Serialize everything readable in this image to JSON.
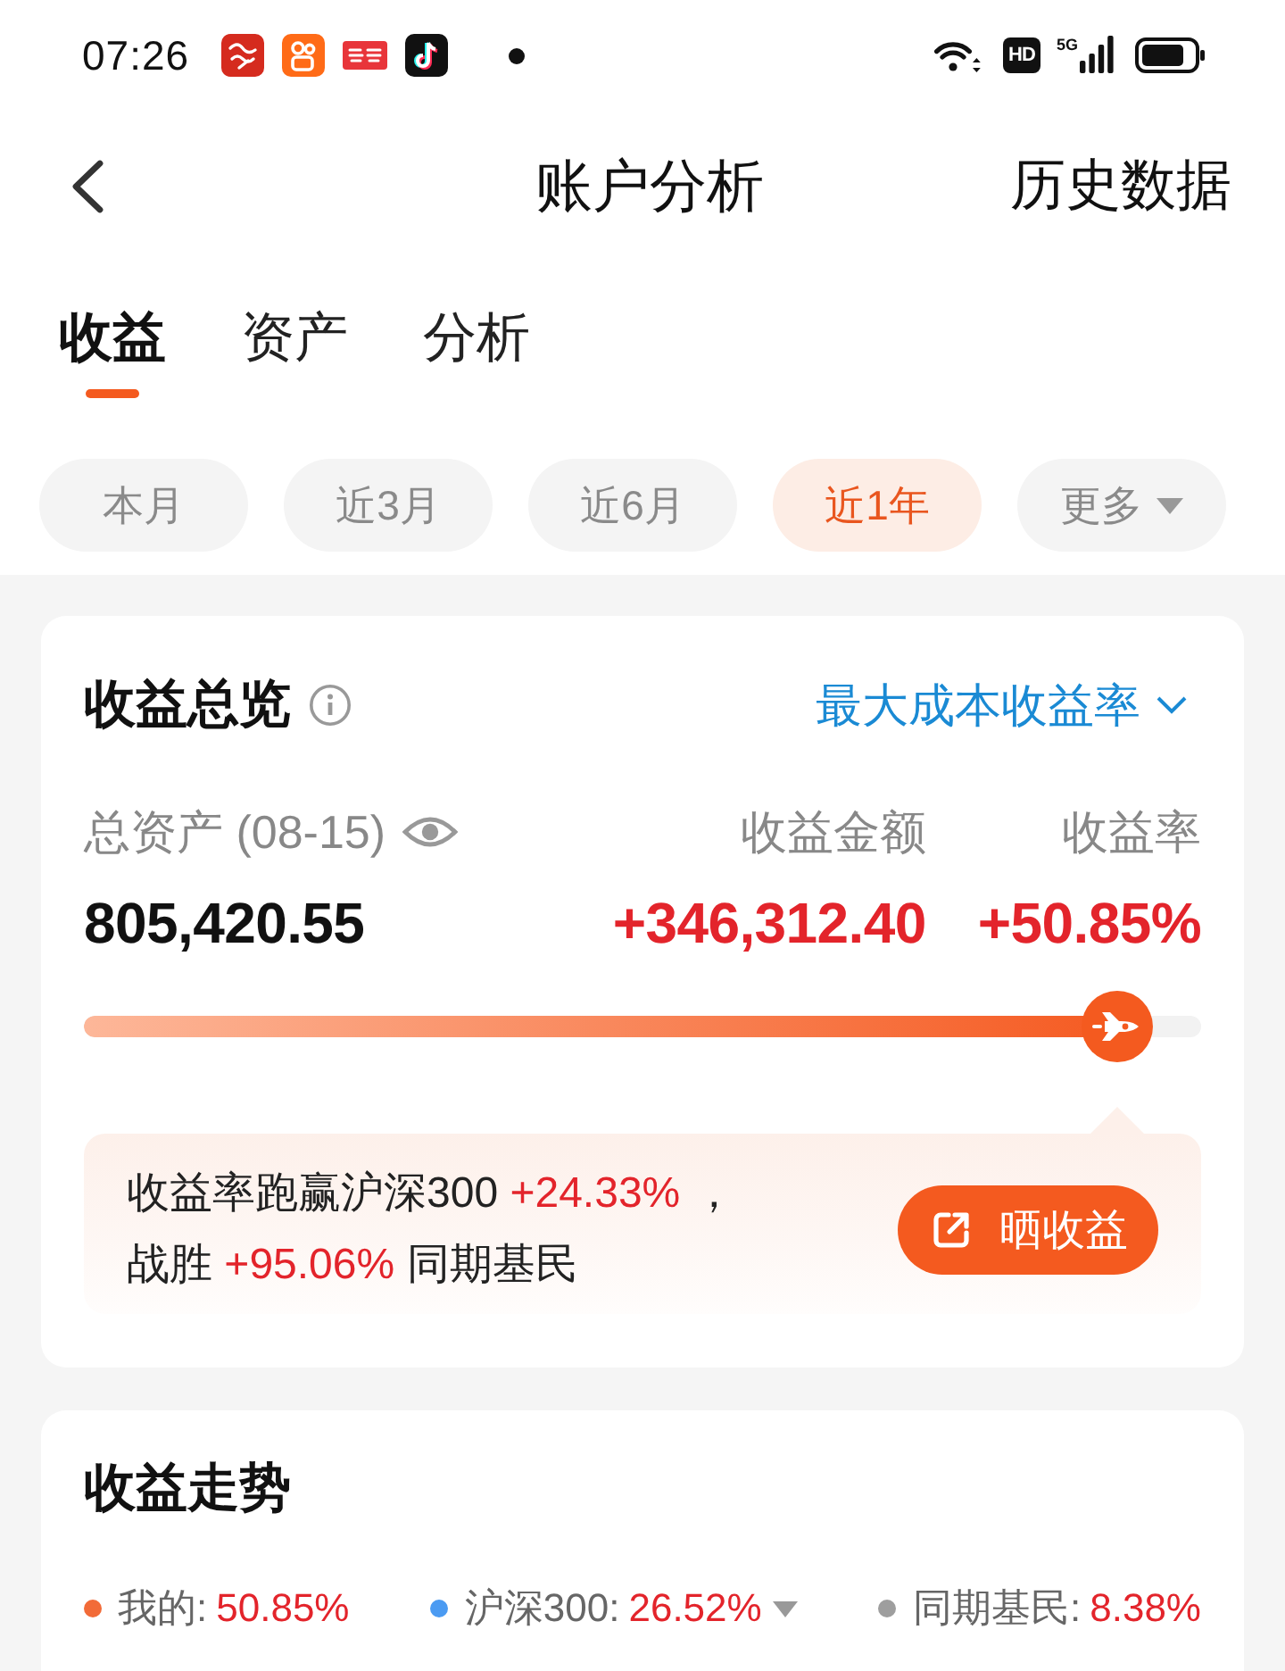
{
  "status_bar": {
    "time": "07:26",
    "hd_label": "HD",
    "network_label": "5G"
  },
  "header": {
    "title": "账户分析",
    "action": "历史数据"
  },
  "tabs": [
    {
      "label": "收益",
      "selected": true
    },
    {
      "label": "资产",
      "selected": false
    },
    {
      "label": "分析",
      "selected": false
    }
  ],
  "periods": [
    {
      "label": "本月",
      "selected": false,
      "kind": "option"
    },
    {
      "label": "近3月",
      "selected": false,
      "kind": "option"
    },
    {
      "label": "近6月",
      "selected": false,
      "kind": "option"
    },
    {
      "label": "近1年",
      "selected": true,
      "kind": "option"
    },
    {
      "label": "更多",
      "selected": false,
      "kind": "dropdown"
    }
  ],
  "overview": {
    "title": "收益总览",
    "metric_selector": "最大成本收益率",
    "columns": [
      {
        "label": "总资产 (08-15)",
        "value": "805,420.55",
        "kind": "assets"
      },
      {
        "label": "收益金额",
        "value": "+346,312.40",
        "kind": "profit"
      },
      {
        "label": "收益率",
        "value": "+50.85%",
        "kind": "profit"
      }
    ],
    "progress": {
      "level": 0.925
    },
    "summary": [
      [
        {
          "text": "收益率跑赢沪深300 ",
          "highlight": false
        },
        {
          "text": "+24.33%",
          "highlight": true
        },
        {
          "text": " ，",
          "highlight": false
        }
      ],
      [
        {
          "text": "战胜 ",
          "highlight": false
        },
        {
          "text": "+95.06%",
          "highlight": true
        },
        {
          "text": " 同期基民",
          "highlight": false
        }
      ]
    ],
    "share_button": "晒收益"
  },
  "trend": {
    "title": "收益走势",
    "legend": [
      {
        "label": "我的:",
        "value": "50.85%",
        "color": "#f26b38",
        "has_menu": false
      },
      {
        "label": "沪深300:",
        "value": "26.52%",
        "color": "#4b9bf2",
        "has_menu": true
      },
      {
        "label": "同期基民:",
        "value": "8.38%",
        "color": "#9e9e9e",
        "has_menu": false
      }
    ]
  }
}
